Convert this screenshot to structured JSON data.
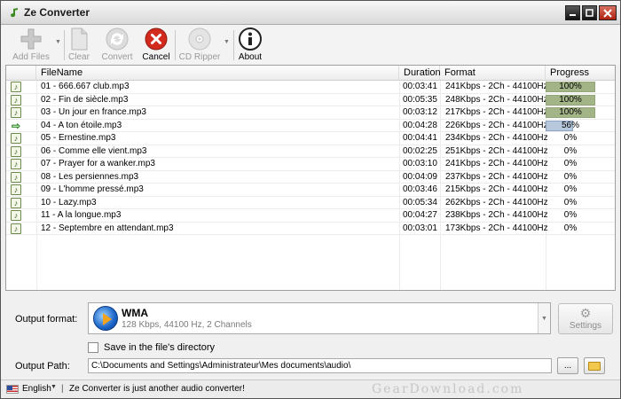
{
  "window": {
    "title": "Ze Converter",
    "controls": [
      "minimize",
      "maximize",
      "close"
    ]
  },
  "toolbar": {
    "buttons": [
      {
        "label": "Add Files",
        "icon": "plus-icon",
        "enabled": false,
        "has_dropdown": true
      },
      {
        "label": "Clear",
        "icon": "document-icon",
        "enabled": false
      },
      {
        "label": "Convert",
        "icon": "refresh-icon",
        "enabled": false
      },
      {
        "label": "Cancel",
        "icon": "cancel-icon",
        "enabled": true
      },
      {
        "label": "CD Ripper",
        "icon": "cd-icon",
        "enabled": false,
        "has_dropdown": true
      },
      {
        "label": "About",
        "icon": "info-icon",
        "enabled": true
      }
    ]
  },
  "file_list": {
    "columns": [
      "",
      "FileName",
      "Duration",
      "Format",
      "Progress"
    ],
    "rows": [
      {
        "icon": "audio-file-icon",
        "name": "01 - 666.667 club.mp3",
        "duration": "00:03:41",
        "format": "241Kbps - 2Ch - 44100Hz",
        "progress_text": "100%",
        "progress": 100
      },
      {
        "icon": "audio-file-icon",
        "name": "02 - Fin de siècle.mp3",
        "duration": "00:05:35",
        "format": "248Kbps - 2Ch - 44100Hz",
        "progress_text": "100%",
        "progress": 100
      },
      {
        "icon": "audio-file-icon",
        "name": "03 - Un jour en france.mp3",
        "duration": "00:03:12",
        "format": "217Kbps - 2Ch - 44100Hz",
        "progress_text": "100%",
        "progress": 100
      },
      {
        "icon": "arrow-right-icon",
        "name": "04 - A ton étoile.mp3",
        "duration": "00:04:28",
        "format": "226Kbps - 2Ch - 44100Hz",
        "progress_text": "56%",
        "progress": 56
      },
      {
        "icon": "audio-file-icon",
        "name": "05 - Ernestine.mp3",
        "duration": "00:04:41",
        "format": "234Kbps - 2Ch - 44100Hz",
        "progress_text": "0%",
        "progress": 0
      },
      {
        "icon": "audio-file-icon",
        "name": "06 - Comme elle vient.mp3",
        "duration": "00:02:25",
        "format": "251Kbps - 2Ch - 44100Hz",
        "progress_text": "0%",
        "progress": 0
      },
      {
        "icon": "audio-file-icon",
        "name": "07 - Prayer for a wanker.mp3",
        "duration": "00:03:10",
        "format": "241Kbps - 2Ch - 44100Hz",
        "progress_text": "0%",
        "progress": 0
      },
      {
        "icon": "audio-file-icon",
        "name": "08 - Les persiennes.mp3",
        "duration": "00:04:09",
        "format": "237Kbps - 2Ch - 44100Hz",
        "progress_text": "0%",
        "progress": 0
      },
      {
        "icon": "audio-file-icon",
        "name": "09 - L'homme pressé.mp3",
        "duration": "00:03:46",
        "format": "215Kbps - 2Ch - 44100Hz",
        "progress_text": "0%",
        "progress": 0
      },
      {
        "icon": "audio-file-icon",
        "name": "10 - Lazy.mp3",
        "duration": "00:05:34",
        "format": "262Kbps - 2Ch - 44100Hz",
        "progress_text": "0%",
        "progress": 0
      },
      {
        "icon": "audio-file-icon",
        "name": "11 - A la longue.mp3",
        "duration": "00:04:27",
        "format": "238Kbps - 2Ch - 44100Hz",
        "progress_text": "0%",
        "progress": 0
      },
      {
        "icon": "audio-file-icon",
        "name": "12 - Septembre en attendant.mp3",
        "duration": "00:03:01",
        "format": "173Kbps - 2Ch - 44100Hz",
        "progress_text": "0%",
        "progress": 0
      }
    ]
  },
  "output": {
    "format_label": "Output format:",
    "format_name": "WMA",
    "format_details": "128 Kbps, 44100 Hz, 2 Channels",
    "settings_label": "Settings",
    "save_in_dir_label": "Save in the file's directory",
    "save_in_dir_checked": false,
    "path_label": "Output Path:",
    "path_value": "C:\\Documents and Settings\\Administrateur\\Mes documents\\audio\\",
    "browse_label": "..."
  },
  "status": {
    "language": "English",
    "separator": "|",
    "message": "Ze Converter is just another audio converter!",
    "watermark": "GearDownload.com"
  },
  "colors": {
    "progress_done": "#a3b587",
    "progress_partial": "#b7c7dc",
    "cancel_red": "#d32a1e",
    "accent_blue": "#1b64c8"
  }
}
